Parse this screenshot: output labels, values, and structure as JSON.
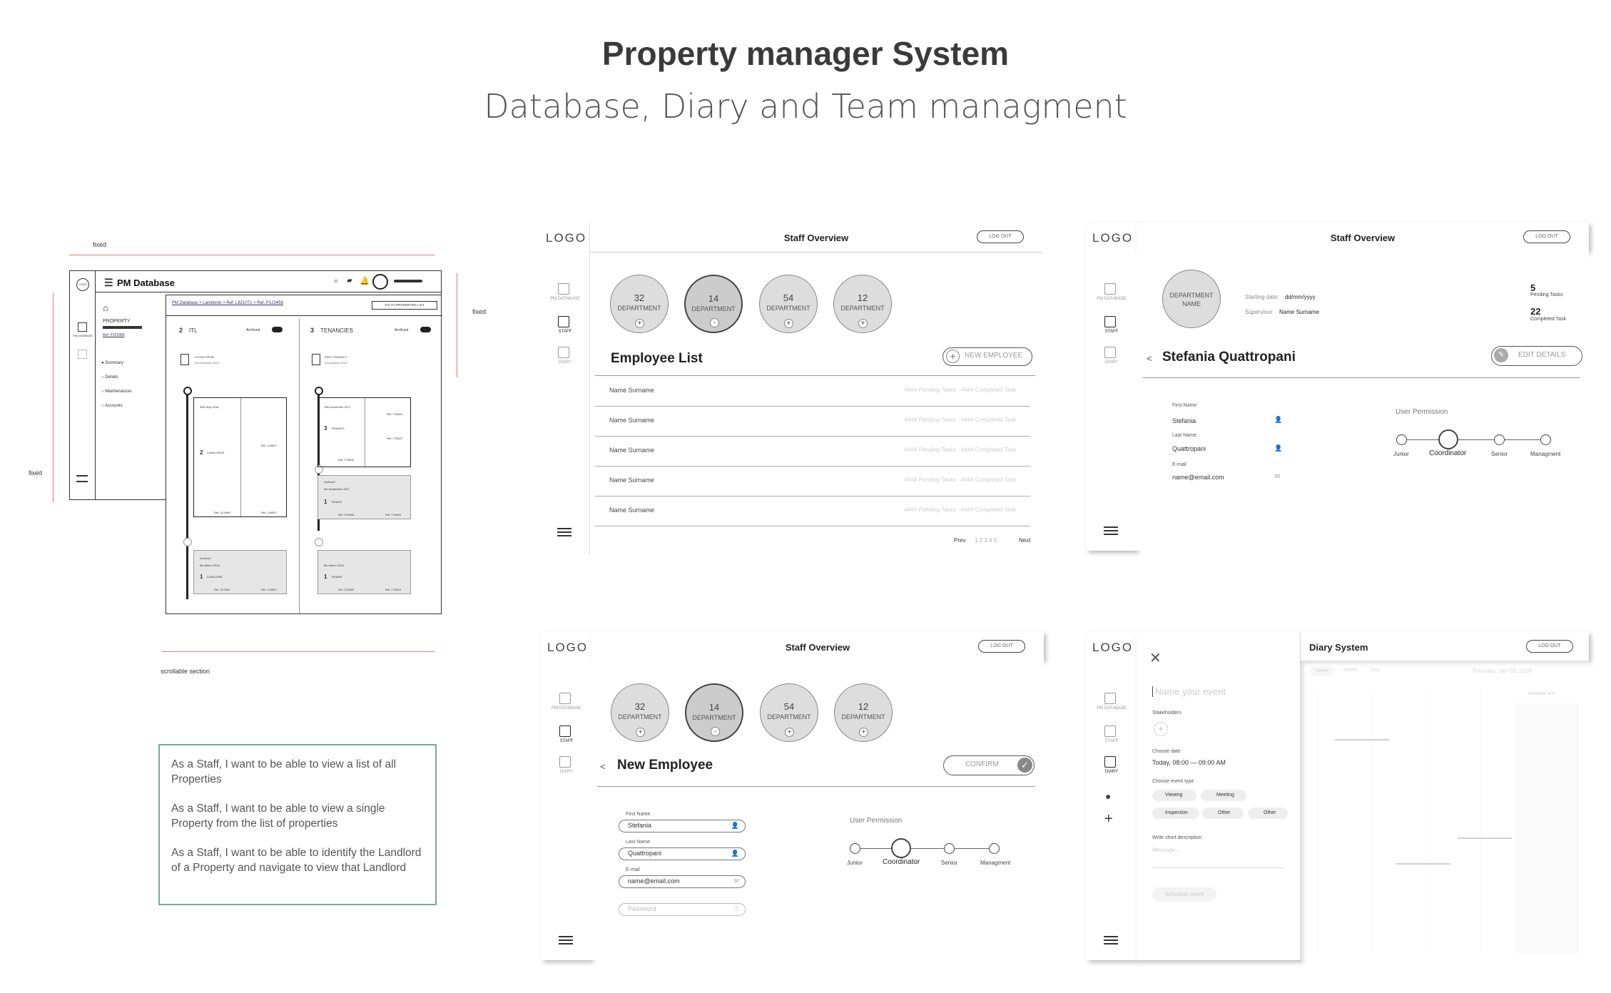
{
  "header": {
    "title": "Property manager System",
    "subtitle": "Database, Diary and Team managment"
  },
  "annotations": {
    "fixed_top": "fixed",
    "fixed_right": "fixed",
    "fixed_left": "fixed",
    "scrollable": "scrollable section"
  },
  "user_stories": [
    "As a Staff, I want to be able to view a list of all Properties",
    "As a Staff, I want to be able to view a single Property from the list of properties",
    "As a Staff, I want to be able to identify the Landlord of a Property and navigate to view that Landlord"
  ],
  "pm": {
    "logo": "LOGO",
    "title": "PM Database",
    "nav": "PM DATABASE",
    "breadcrumb": "PM Database > Landlords > Ref. L821071 > Ref. P123456",
    "go_list": "GO TO PROPERTIES LIST",
    "property": "PROPERTY",
    "ref": "Ref. P123456",
    "menu": [
      "Summary",
      "Details",
      "Maintenances",
      "Accounts"
    ],
    "col1": {
      "count": "2",
      "title": "ITL",
      "archived": "Archived",
      "listed": "LISTED FROM",
      "listed_date": "2nd February 2019",
      "from": "30th May 2018",
      "landlords": "LANDLORDS",
      "ref": "Ref. L04807",
      "ref2": "Ref. ZLS908",
      "ref3": "Ref. L04807",
      "archived_tag": "Archived",
      "date2": "6th March 2016",
      "landlord": "LANDLORD",
      "ref4": "Ref. ZLS909",
      "ref5": "Ref. L04807",
      "count2": "1",
      "count3": "2"
    },
    "col2": {
      "count": "3",
      "title": "TENANCIES",
      "archived": "Archived",
      "first": "FIRST TENANCY",
      "first_date": "22nd March 2016",
      "from": "19th November 2017",
      "tenants": "TENANTS",
      "ref": "Ref. T76900",
      "ref2": "Ref. T76901",
      "ref3": "Ref. T76902",
      "archived_tag": "Archived",
      "date2": "4th September 2017",
      "tenant": "TENANT",
      "ref4": "Ref. Z76909",
      "ref5": "Ref. T76909",
      "date3": "6th March 2016",
      "tenant2": "TENANT",
      "ref6": "Ref. Z76909",
      "ref7": "Ref. T76904",
      "count2": "3",
      "count3": "1",
      "count4": "1"
    }
  },
  "common": {
    "logo": "LOGO",
    "nav_pm": "PM DATABASE",
    "nav_staff": "STAFF",
    "nav_diary": "DIARY",
    "logout": "LOG OUT",
    "staff_title": "Staff Overview",
    "department": "DEPARTMENT"
  },
  "departments": [
    {
      "count": "32",
      "sign": "+"
    },
    {
      "count": "14",
      "sign": "-"
    },
    {
      "count": "54",
      "sign": "+"
    },
    {
      "count": "12",
      "sign": "+"
    }
  ],
  "employee_list": {
    "title": "Employee List",
    "new_btn": "NEW EMPLOYEE",
    "rows": [
      {
        "name": "Name Surname",
        "tasks": "#### Pending Tasks · #### Completed Task"
      },
      {
        "name": "Name Surname",
        "tasks": "#### Pending Tasks · #### Completed Task"
      },
      {
        "name": "Name Surname",
        "tasks": "#### Pending Tasks · #### Completed Task"
      },
      {
        "name": "Name Surname",
        "tasks": "#### Pending Tasks · #### Completed Task"
      },
      {
        "name": "Name Surname",
        "tasks": "#### Pending Tasks · #### Completed Task"
      }
    ],
    "pager": {
      "prev": "Prev",
      "pages": "1  2  3  4  5",
      "next": "Next"
    }
  },
  "profile": {
    "dept_line1": "DEPARTMENT",
    "dept_line2": "NAME",
    "start_label": "Starting date:",
    "start_value": "dd/mm/yyyy",
    "sup_label": "Supervisor:",
    "sup_value": "Name Surname",
    "pending_n": "5",
    "pending_l": "Pending Tasks",
    "completed_n": "22",
    "completed_l": "Completed Task",
    "name": "Stefania Quattropani",
    "edit": "EDIT DETAILS",
    "first_label": "First Name",
    "first": "Stefania",
    "last_label": "Last Name",
    "last": "Quattropani",
    "email_label": "E-mail",
    "email": "name@email.com"
  },
  "permission": {
    "label": "User Permission",
    "levels": [
      "Junior",
      "Coordinator",
      "Senior",
      "Managment"
    ]
  },
  "new_employee": {
    "title": "New Employee",
    "confirm": "CONFIRM",
    "first_label": "First Name",
    "first": "Stefania",
    "last_label": "Last Name",
    "last": "Quattropani",
    "email_label": "E-mail",
    "email": "name@email.com",
    "password": "Password"
  },
  "diary": {
    "title": "Diary System",
    "event_placeholder": "Name your event",
    "stakeholders": "Stakeholders",
    "choose_date": "Choose date",
    "date_value": "Today, 08:00 — 09:00 AM",
    "event_type": "Choose event type",
    "types": [
      "Viewing",
      "Meeting",
      "Inspection",
      "Other",
      "Other"
    ],
    "desc_label": "Write short description",
    "desc_placeholder": "Message...",
    "schedule": "Schedule event",
    "tabs": [
      "Week",
      "Month",
      "Day"
    ],
    "date": "Thursday, Jan 18, 2018",
    "col_head": "THURSDAY 4/18"
  }
}
